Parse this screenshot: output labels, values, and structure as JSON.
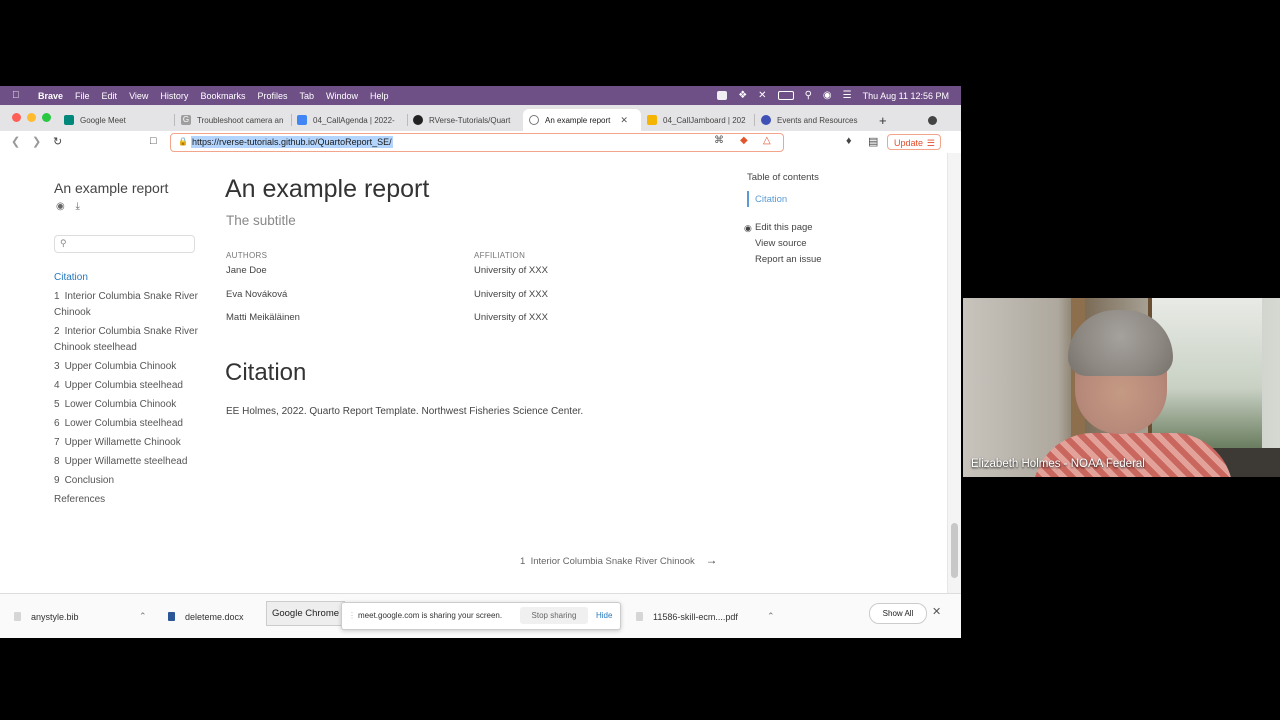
{
  "menubar": {
    "app": "Brave",
    "items": [
      "File",
      "Edit",
      "View",
      "History",
      "Bookmarks",
      "Profiles",
      "Tab",
      "Window",
      "Help"
    ],
    "clock": "Thu Aug 11  12:56 PM"
  },
  "tabs": [
    {
      "label": "Google Meet",
      "color": "#00897b",
      "glyph": ""
    },
    {
      "label": "Troubleshoot camera an",
      "color": "#9e9e9e",
      "glyph": "G"
    },
    {
      "label": "04_CallAgenda | 2022-",
      "color": "#4285f4",
      "glyph": ""
    },
    {
      "label": "RVerse-Tutorials/Quart",
      "color": "#222222",
      "glyph": ""
    },
    {
      "label": "An example report",
      "color": "#777777",
      "glyph": ""
    },
    {
      "label": "04_CallJamboard | 202",
      "color": "#f4b400",
      "glyph": ""
    },
    {
      "label": "Events and Resources",
      "color": "#3f51b5",
      "glyph": ""
    }
  ],
  "toolbar": {
    "url": "https://rverse-tutorials.github.io/QuartoReport_SE/",
    "update_label": "Update"
  },
  "sidebar": {
    "title": "An example report",
    "items": [
      {
        "num": "",
        "label": "Citation"
      },
      {
        "num": "1",
        "label": "Interior Columbia Snake River Chinook"
      },
      {
        "num": "2",
        "label": "Interior Columbia Snake River Chinook steelhead"
      },
      {
        "num": "3",
        "label": "Upper Columbia Chinook"
      },
      {
        "num": "4",
        "label": "Upper Columbia steelhead"
      },
      {
        "num": "5",
        "label": "Lower Columbia Chinook"
      },
      {
        "num": "6",
        "label": "Lower Columbia steelhead"
      },
      {
        "num": "7",
        "label": "Upper Willamette Chinook"
      },
      {
        "num": "8",
        "label": "Upper Willamette steelhead"
      },
      {
        "num": "9",
        "label": "Conclusion"
      },
      {
        "num": "",
        "label": "References"
      }
    ]
  },
  "main": {
    "title": "An example report",
    "subtitle": "The subtitle",
    "authors_header": "AUTHORS",
    "affiliation_header": "AFFILIATION",
    "authors": [
      {
        "name": "Jane Doe",
        "affiliation": "University of XXX"
      },
      {
        "name": "Eva Nováková",
        "affiliation": "University of XXX"
      },
      {
        "name": "Matti Meikäläinen",
        "affiliation": "University of XXX"
      }
    ],
    "section_heading": "Citation",
    "citation_text": "EE Holmes, 2022. Quarto Report Template. Northwest Fisheries Science Center.",
    "next_num": "1",
    "next_label": "Interior Columbia Snake River Chinook"
  },
  "toc": {
    "title": "Table of contents",
    "active_item": "Citation",
    "edit": "Edit this page",
    "view_source": "View source",
    "report_issue": "Report an issue"
  },
  "downloads": {
    "file1": "anystyle.bib",
    "file2": "deleteme.docx",
    "file3": "11586-skill-ecm....pdf",
    "tooltip": "Google Chrome",
    "share_message": "meet.google.com is sharing your screen.",
    "stop_label": "Stop sharing",
    "hide_label": "Hide",
    "show_all": "Show All"
  },
  "video": {
    "participant": "Elizabeth Holmes - NOAA Federal"
  }
}
